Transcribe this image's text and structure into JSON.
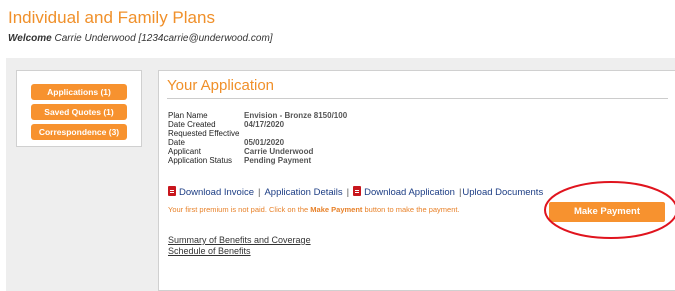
{
  "header": {
    "title": "Individual and Family Plans",
    "welcome_label": "Welcome",
    "welcome_user": "Carrie Underwood [1234carrie@underwood.com]"
  },
  "sidebar": {
    "items": [
      {
        "label": "Applications (1)"
      },
      {
        "label": "Saved Quotes (1)"
      },
      {
        "label": "Correspondence (3)"
      }
    ]
  },
  "application": {
    "title": "Your Application",
    "fields": [
      {
        "label": "Plan Name",
        "value": "Envision - Bronze 8150/100"
      },
      {
        "label": "Date Created",
        "value": "04/17/2020"
      },
      {
        "label": "Requested Effective Date",
        "value": "05/01/2020"
      },
      {
        "label": "Applicant",
        "value": "Carrie Underwood"
      },
      {
        "label": "Application Status",
        "value": "Pending Payment"
      }
    ],
    "links": {
      "download_invoice": "Download Invoice",
      "application_details": "Application Details",
      "download_application": "Download Application",
      "upload_documents": "Upload Documents"
    },
    "notice": {
      "before": "Your first premium is not paid. Click on the ",
      "emphasis": "Make Payment",
      "after": " button to make the payment."
    },
    "make_payment_label": "Make Payment",
    "documents": [
      "Summary of Benefits and Coverage",
      "Schedule of Benefits"
    ]
  },
  "colors": {
    "accent_orange": "#f7922f",
    "link_blue": "#1c3d84",
    "highlight_red": "#e0141e"
  }
}
